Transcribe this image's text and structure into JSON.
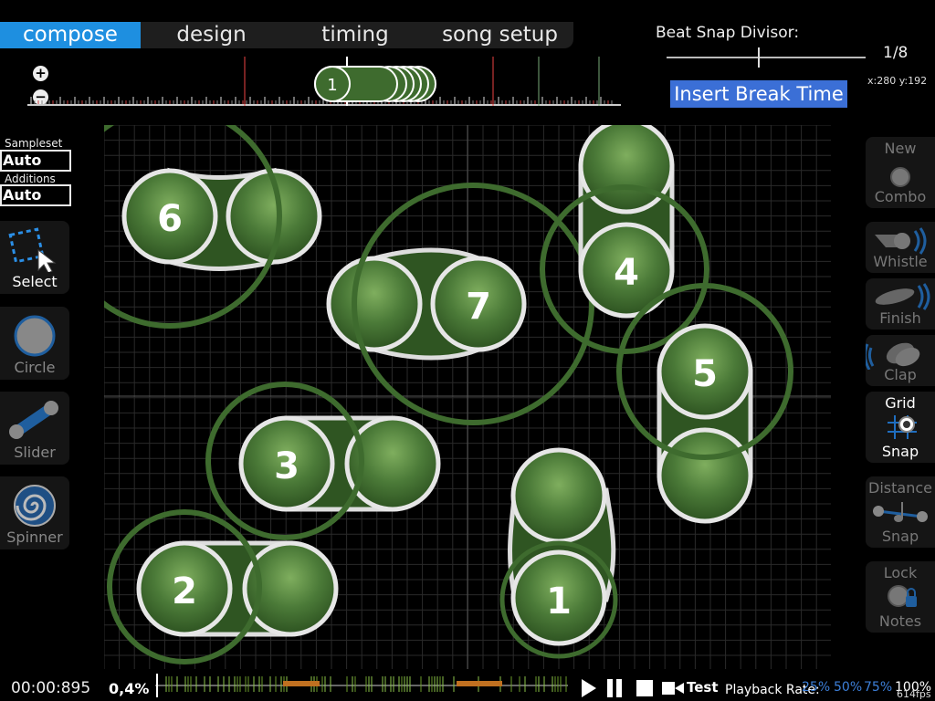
{
  "tabs": [
    {
      "label": "compose",
      "active": true
    },
    {
      "label": "design",
      "active": false
    },
    {
      "label": "timing",
      "active": false
    },
    {
      "label": "song setup",
      "active": false
    }
  ],
  "beat_snap": {
    "label": "Beat Snap Divisor:",
    "value": "1/8"
  },
  "coords": "x:280 y:192",
  "insert_break": "Insert Break Time",
  "timeline": {
    "zoom_in": "+",
    "zoom_out": "−",
    "current_combo": "1"
  },
  "left_panel": {
    "sampleset_label": "Sampleset",
    "sampleset_value": "Auto",
    "additions_label": "Additions",
    "additions_value": "Auto",
    "tools": [
      {
        "label": "Select",
        "icon": "select-icon",
        "active": true
      },
      {
        "label": "Circle",
        "icon": "circle-icon",
        "active": false
      },
      {
        "label": "Slider",
        "icon": "slider-icon",
        "active": false
      },
      {
        "label": "Spinner",
        "icon": "spinner-icon",
        "active": false
      }
    ]
  },
  "right_panel": {
    "new_combo": {
      "line1": "New",
      "line2": "Combo"
    },
    "whistle": "Whistle",
    "finish": "Finish",
    "clap": "Clap",
    "grid_snap": {
      "line1": "Grid",
      "line2": "Snap"
    },
    "distance_snap": {
      "line1": "Distance",
      "line2": "Snap"
    },
    "lock_notes": {
      "line1": "Lock",
      "line2": "Notes"
    }
  },
  "hit_objects": [
    "1",
    "2",
    "3",
    "4",
    "5",
    "6",
    "7"
  ],
  "bottom": {
    "time": "00:00:895",
    "progress": "0,4%",
    "test": "Test",
    "playback_rate_label": "Playback Rate:",
    "rates": [
      "25%",
      "50%",
      "75%",
      "100%"
    ],
    "fps": "614fps"
  },
  "colors": {
    "accent": "#1e8fe0",
    "combo": "#3e6b2e",
    "break_button": "#3b6fd6",
    "rate_link": "#3d7fd8"
  }
}
